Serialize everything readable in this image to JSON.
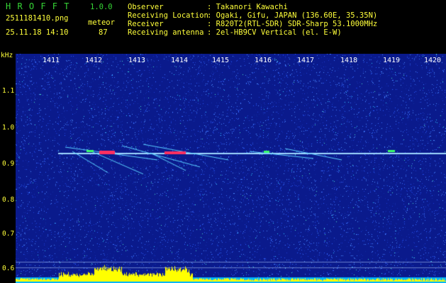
{
  "header": {
    "logo": "H R O F F T",
    "version": "1.0.0",
    "filename": "2511181410.png",
    "mode": "meteor",
    "datetime": "25.11.18 14:10",
    "count": "87",
    "observer_label": "Observer",
    "observer_value": ": Takanori Kawachi",
    "location_label": "Receiving Location",
    "location_value": ": Ogaki, Gifu, JAPAN (136.60E, 35.35N)",
    "receiver_label": "Receiver",
    "receiver_value": ": R820T2(RTL-SDR) SDR-Sharp 53.1000MHz",
    "antenna_label": "Receiving antenna",
    "antenna_value": ": 2el-HB9CV Vertical (el. E-W)"
  },
  "axis": {
    "unit": "kHz",
    "y_ticks": [
      "1.1",
      "1.0",
      "0.9",
      "0.8",
      "0.7",
      "0.6"
    ],
    "x_ticks": [
      "1411",
      "1412",
      "1413",
      "1414",
      "1415",
      "1416",
      "1417",
      "1418",
      "1419",
      "1420"
    ]
  },
  "colors": {
    "background_noise": "#0a1a8c",
    "header_text": "#ffff3a",
    "logo_text": "#36d636",
    "minute_label": "#ffffff",
    "carrier": "#9fd8ff",
    "strong_echo": "#ff3060",
    "activity_bar": "#ffff00",
    "bottom_bar": "#00b4ff"
  }
}
